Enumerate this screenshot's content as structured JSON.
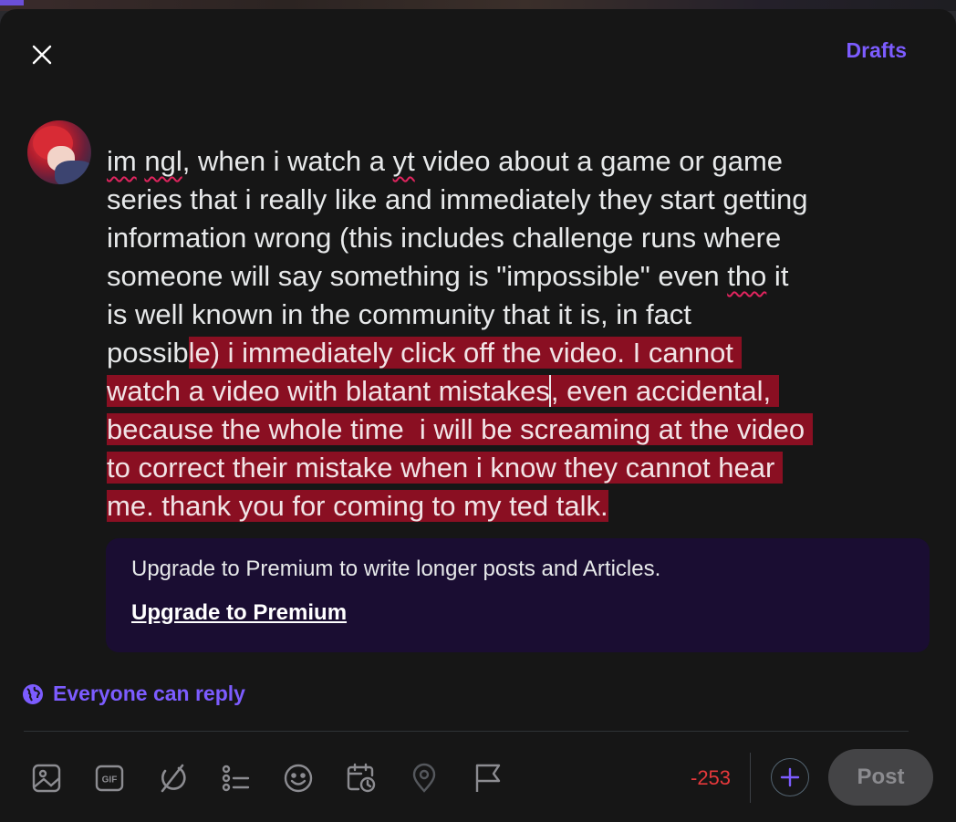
{
  "header": {
    "close_icon": "close-icon",
    "drafts_label": "Drafts"
  },
  "composer": {
    "avatar": "user-avatar",
    "lines": [
      [
        {
          "t": "im",
          "s": "squig"
        },
        {
          "t": " "
        },
        {
          "t": "ngl",
          "s": "squig"
        },
        {
          "t": ", when i watch a "
        },
        {
          "t": "yt",
          "s": "squig"
        },
        {
          "t": " video about a game or game"
        }
      ],
      [
        {
          "t": "series that i really like and immediately they start getting"
        }
      ],
      [
        {
          "t": "information wrong (this includes challenge runs where"
        }
      ],
      [
        {
          "t": "someone will say something is \"impossible\" even "
        },
        {
          "t": "tho",
          "s": "squig"
        },
        {
          "t": " it"
        }
      ],
      [
        {
          "t": "is well known in the community that it is, in fact"
        }
      ],
      [
        {
          "t": "possib"
        },
        {
          "t": "le) i immediately click off the video. I cannot ",
          "s": "sel"
        }
      ],
      [
        {
          "t": "watch a video with blatant mistakes",
          "s": "sel"
        },
        {
          "t": "",
          "s": "caret"
        },
        {
          "t": ", even accidental, ",
          "s": "sel"
        }
      ],
      [
        {
          "t": "because the whole time  i will be screaming at the video ",
          "s": "sel"
        }
      ],
      [
        {
          "t": "to correct their mistake when i know they cannot hear ",
          "s": "sel"
        }
      ],
      [
        {
          "t": "me. thank you for coming to my ted talk.",
          "s": "sel"
        }
      ]
    ]
  },
  "premium": {
    "message": "Upgrade to Premium to write longer posts and Articles.",
    "link": "Upgrade to Premium"
  },
  "reply_setting": {
    "icon": "globe-icon",
    "label": "Everyone can reply"
  },
  "toolbar": {
    "tools": [
      "image-icon",
      "gif-icon",
      "grok-icon",
      "poll-icon",
      "emoji-icon",
      "schedule-icon",
      "location-icon",
      "flag-icon"
    ],
    "char_count": "-253",
    "add_icon": "plus-icon",
    "post_label": "Post"
  },
  "colors": {
    "accent": "#7c5cff",
    "selection": "#8a0f22",
    "over_limit": "#e5383b",
    "premium_bg": "#1a0d32"
  }
}
